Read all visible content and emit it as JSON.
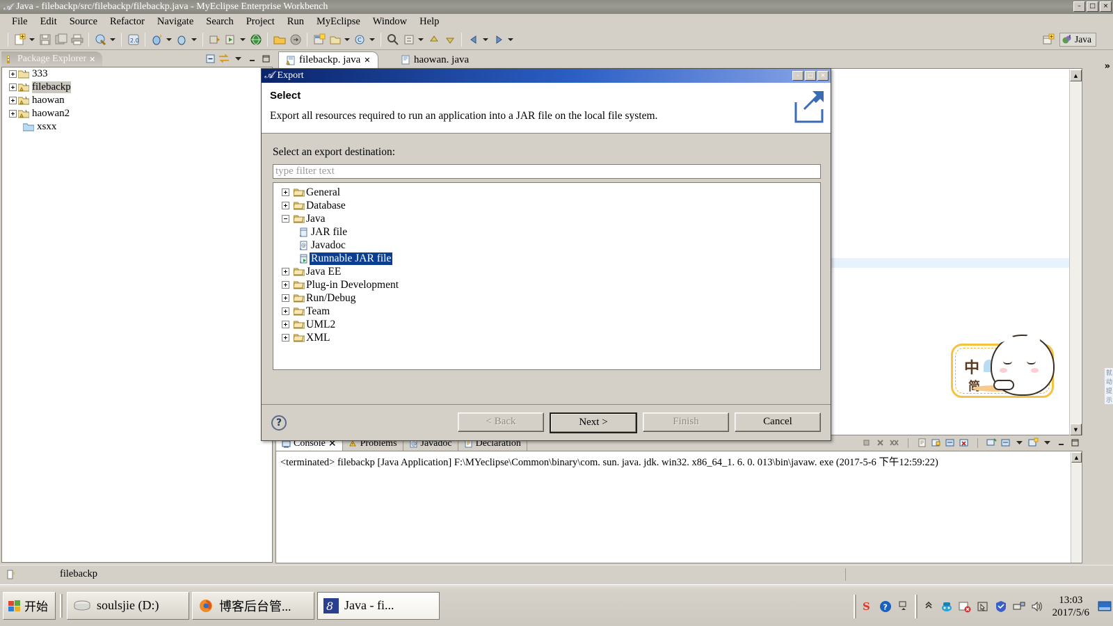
{
  "window": {
    "title": "Java - filebackp/src/filebackp/filebackp.java - MyEclipse Enterprise Workbench",
    "app_icon": "myeclipse-icon",
    "minimize": "–",
    "maximize": "□",
    "close": "×"
  },
  "menu": {
    "items": [
      {
        "label": "File"
      },
      {
        "label": "Edit"
      },
      {
        "label": "Source"
      },
      {
        "label": "Refactor"
      },
      {
        "label": "Navigate"
      },
      {
        "label": "Search"
      },
      {
        "label": "Project"
      },
      {
        "label": "Run"
      },
      {
        "label": "MyEclipse"
      },
      {
        "label": "Window"
      },
      {
        "label": "Help"
      }
    ]
  },
  "toolbar": {
    "perspective_label": "Java",
    "overflow_label": "»"
  },
  "package_explorer": {
    "tab_label": "Package Explorer",
    "close_glyph": "✕",
    "tools": [
      "collapse-all-icon",
      "link-with-editor-icon",
      "view-menu-icon",
      "minimize-icon",
      "maximize-icon"
    ],
    "tree": [
      {
        "label": "333",
        "expandable": true,
        "selected": false,
        "icon": "java-project-icon"
      },
      {
        "label": "filebackp",
        "expandable": true,
        "selected": true,
        "icon": "java-project-warning-icon"
      },
      {
        "label": "haowan",
        "expandable": true,
        "selected": false,
        "icon": "java-project-warning-icon"
      },
      {
        "label": "haowan2",
        "expandable": true,
        "selected": false,
        "icon": "java-project-warning-icon"
      },
      {
        "label": "xsxx",
        "expandable": false,
        "selected": false,
        "icon": "folder-icon"
      }
    ]
  },
  "editor": {
    "tabs": [
      {
        "label": "filebackp. java",
        "active": true,
        "icon": "java-file-warning-icon",
        "close_glyph": "✕"
      },
      {
        "label": "haowan. java",
        "active": false,
        "icon": "java-file-icon",
        "close_glyph": ""
      }
    ],
    "ime_hint": "就动提示"
  },
  "ime_card": {
    "char_top": "中",
    "char_bottom": "简",
    "mascot": "cat-mascot-icon"
  },
  "console": {
    "tabs": [
      {
        "label": "Console",
        "active": true,
        "icon": "console-icon",
        "close_glyph": "✕"
      },
      {
        "label": "Problems",
        "active": false,
        "icon": "problems-icon"
      },
      {
        "label": "Javadoc",
        "active": false,
        "icon": "javadoc-icon"
      },
      {
        "label": "Declaration",
        "active": false,
        "icon": "declaration-icon"
      }
    ],
    "output": "<terminated> filebackp [Java Application] F:\\MYeclipse\\Common\\binary\\com. sun. java. jdk. win32. x86_64_1. 6. 0. 013\\bin\\javaw. exe  (2017-5-6  下午12:59:22)"
  },
  "statusbar": {
    "label": "filebackp",
    "icon": "writable-icon"
  },
  "taskbar": {
    "start_label": "开始",
    "items": [
      {
        "label": "soulsjie (D:)",
        "icon": "drive-icon",
        "active": false
      },
      {
        "label": "博客后台管...",
        "icon": "firefox-icon",
        "active": false
      },
      {
        "label": "Java - fi...",
        "icon": "myeclipse-icon",
        "active": true
      }
    ],
    "tray_icons": [
      "sogou-icon",
      "help-icon",
      "show-hidden-icon",
      "expand-icon",
      "thunder-icon",
      "antivirus-icon",
      "pointer-icon",
      "shield-icon",
      "network-icon",
      "volume-icon"
    ],
    "clock_time": "13:03",
    "clock_date": "2017/5/6"
  },
  "dialog": {
    "title": "Export",
    "icon": "myeclipse-icon",
    "minimize": "–",
    "maximize": "□",
    "close": "✕",
    "heading": "Select",
    "description": "Export all resources required to run an application into a JAR file on the local file system.",
    "banner_icon": "export-arrow-icon",
    "destination_label": "Select an export destination:",
    "filter_placeholder": "type filter text",
    "filter_value": "",
    "tree": [
      {
        "label": "General",
        "level": 0,
        "state": "collapsed",
        "icon": "folder-icon",
        "selected": false
      },
      {
        "label": "Database",
        "level": 0,
        "state": "collapsed",
        "icon": "folder-icon",
        "selected": false
      },
      {
        "label": "Java",
        "level": 0,
        "state": "expanded",
        "icon": "folder-icon",
        "selected": false
      },
      {
        "label": "JAR file",
        "level": 1,
        "state": "leaf",
        "icon": "jar-icon",
        "selected": false
      },
      {
        "label": "Javadoc",
        "level": 1,
        "state": "leaf",
        "icon": "javadoc-icon",
        "selected": false
      },
      {
        "label": "Runnable JAR file",
        "level": 1,
        "state": "leaf",
        "icon": "runnable-jar-icon",
        "selected": true
      },
      {
        "label": "Java EE",
        "level": 0,
        "state": "collapsed",
        "icon": "folder-icon",
        "selected": false
      },
      {
        "label": "Plug-in Development",
        "level": 0,
        "state": "collapsed",
        "icon": "folder-icon",
        "selected": false
      },
      {
        "label": "Run/Debug",
        "level": 0,
        "state": "collapsed",
        "icon": "folder-icon",
        "selected": false
      },
      {
        "label": "Team",
        "level": 0,
        "state": "collapsed",
        "icon": "folder-icon",
        "selected": false
      },
      {
        "label": "UML2",
        "level": 0,
        "state": "collapsed",
        "icon": "folder-icon",
        "selected": false
      },
      {
        "label": "XML",
        "level": 0,
        "state": "collapsed",
        "icon": "folder-icon",
        "selected": false
      }
    ],
    "help_glyph": "?",
    "buttons": [
      {
        "label": "< Back",
        "enabled": false,
        "default": false
      },
      {
        "label": "Next >",
        "enabled": true,
        "default": true
      },
      {
        "label": "Finish",
        "enabled": false,
        "default": false
      },
      {
        "label": "Cancel",
        "enabled": true,
        "default": false
      }
    ]
  },
  "colors": {
    "dialog_title_start": "#0a246a",
    "dialog_title_end": "#8ba6e8",
    "selection": "#0b3d91",
    "chrome": "#d4d0c8",
    "ime_border": "#f5c242"
  }
}
